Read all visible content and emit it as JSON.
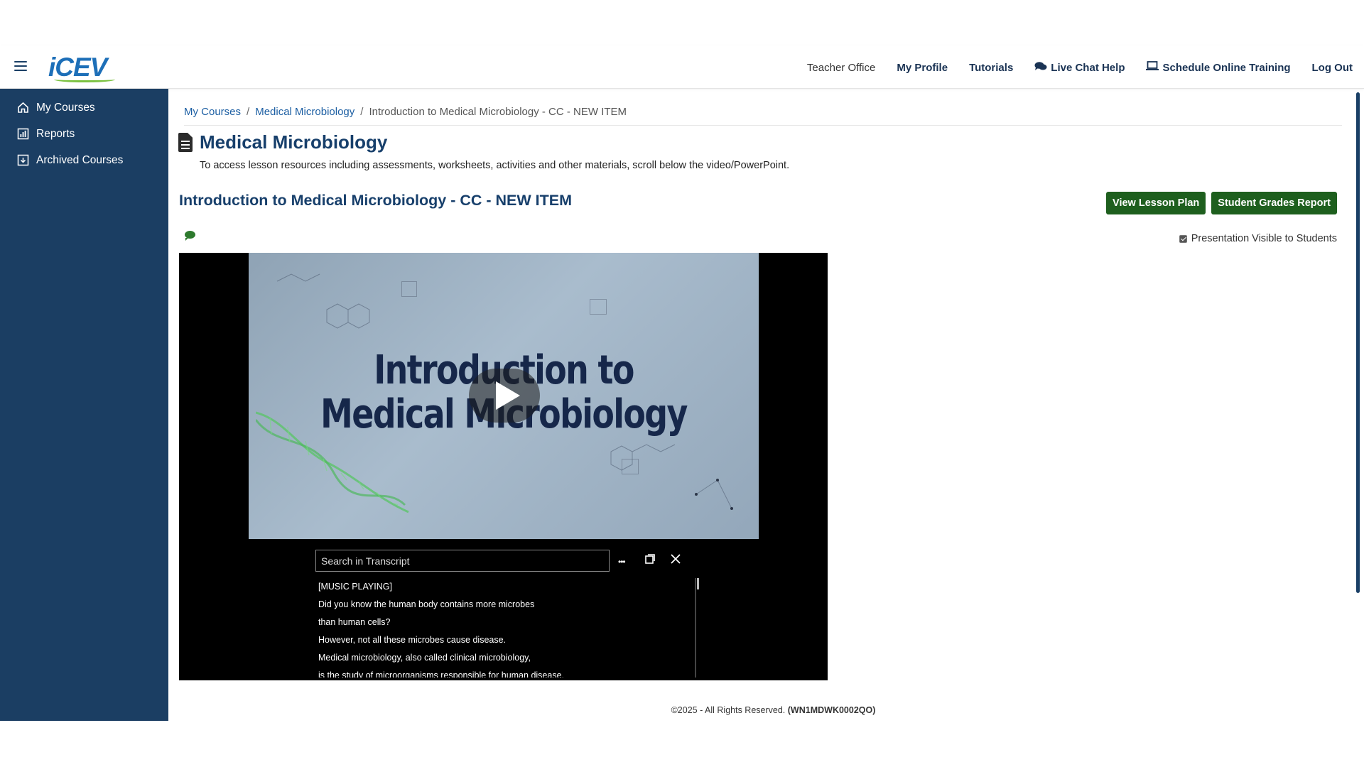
{
  "header": {
    "logo_text": "iCEV",
    "nav": [
      {
        "label": "Teacher Office",
        "icon": ""
      },
      {
        "label": "My Profile",
        "icon": ""
      },
      {
        "label": "Tutorials",
        "icon": ""
      },
      {
        "label": "Live Chat Help",
        "icon": "chat-bubbles-icon"
      },
      {
        "label": "Schedule Online Training",
        "icon": "laptop-icon"
      },
      {
        "label": "Log Out",
        "icon": ""
      }
    ]
  },
  "sidebar": {
    "items": [
      {
        "label": "My Courses",
        "icon": "home-icon"
      },
      {
        "label": "Reports",
        "icon": "chart-icon"
      },
      {
        "label": "Archived Courses",
        "icon": "archive-icon"
      }
    ]
  },
  "breadcrumb": {
    "items": [
      "My Courses",
      "Medical Microbiology"
    ],
    "current": "Introduction to Medical Microbiology - CC - NEW ITEM",
    "separator": "/"
  },
  "page": {
    "title": "Medical Microbiology",
    "subtitle": "To access lesson resources including assessments, worksheets, activities and other materials, scroll below the video/PowerPoint.",
    "lesson_title": "Introduction to Medical Microbiology - CC - NEW ITEM",
    "buttons": {
      "view_lesson_plan": "View Lesson Plan",
      "student_grades_report": "Student Grades Report"
    },
    "visible_label": "Presentation Visible to Students",
    "visible_checked": true
  },
  "video": {
    "slide_title_line1": "Introduction to",
    "slide_title_line2": "Medical Microbiology"
  },
  "transcript": {
    "search_placeholder": "Search in Transcript",
    "more_label": "•••",
    "lines": [
      "[MUSIC PLAYING]",
      "Did you know the human body contains more microbes",
      "than human cells?",
      "However, not all these microbes cause disease.",
      "Medical microbiology, also called clinical microbiology,",
      "is the study of microorganisms responsible for human disease."
    ]
  },
  "footer": {
    "copyright": "©2025 - All Rights Reserved.",
    "code": "(WN1MDWK0002QO)"
  },
  "colors": {
    "sidebar": "#1b3e63",
    "primary_text": "#173f6b",
    "link": "#1d5fa3",
    "button": "#1e5f1e"
  }
}
